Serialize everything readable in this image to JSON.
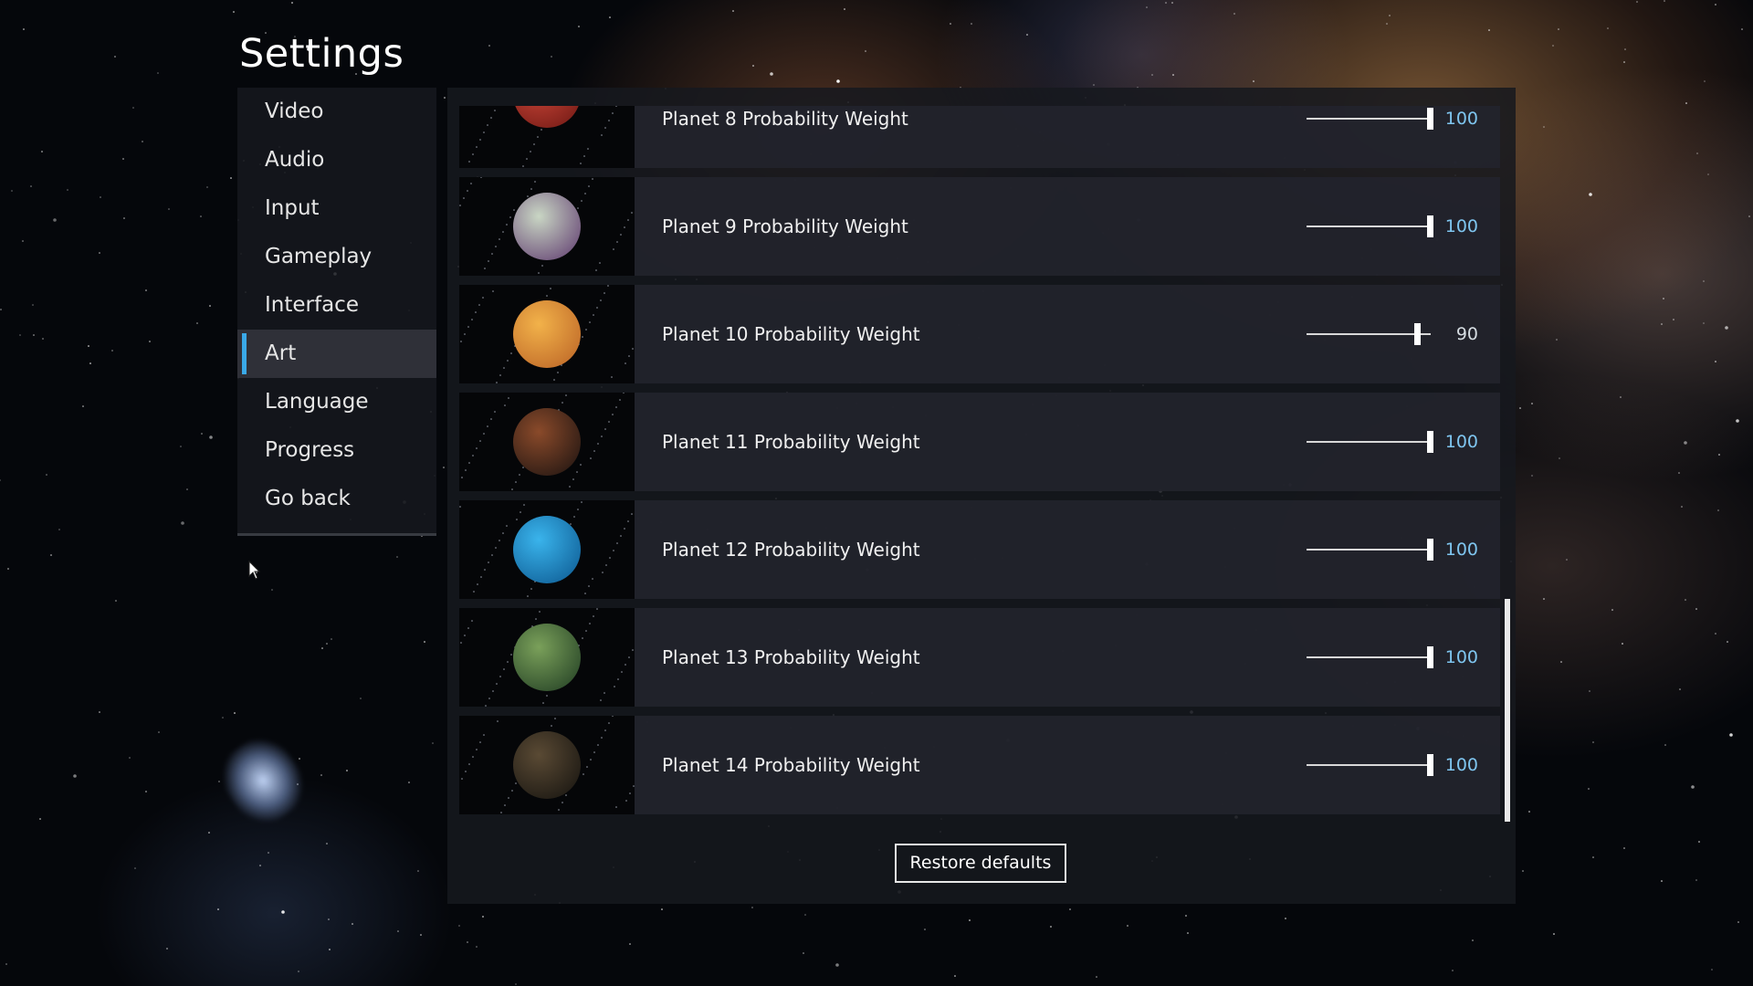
{
  "page_title": "Settings",
  "sidebar": {
    "items": [
      {
        "label": "Video",
        "active": false
      },
      {
        "label": "Audio",
        "active": false
      },
      {
        "label": "Input",
        "active": false
      },
      {
        "label": "Gameplay",
        "active": false
      },
      {
        "label": "Interface",
        "active": false
      },
      {
        "label": "Art",
        "active": true
      },
      {
        "label": "Language",
        "active": false
      },
      {
        "label": "Progress",
        "active": false
      },
      {
        "label": "Go back",
        "active": false
      }
    ]
  },
  "settings_rows": [
    {
      "label": "Planet 8 Probability Weight",
      "value": "100",
      "slider_fraction": 1.0,
      "planet_icon": "red-planet-icon",
      "planet_colors": [
        "#d0483a",
        "#7a1e18"
      ]
    },
    {
      "label": "Planet 9 Probability Weight",
      "value": "100",
      "slider_fraction": 1.0,
      "planet_icon": "crystal-planet-icon",
      "planet_colors": [
        "#c9d6c4",
        "#6d4f7a"
      ]
    },
    {
      "label": "Planet 10 Probability Weight",
      "value": "90",
      "slider_fraction": 0.9,
      "planet_icon": "golden-planet-icon",
      "planet_colors": [
        "#f2b24a",
        "#c26d2a"
      ]
    },
    {
      "label": "Planet 11 Probability Weight",
      "value": "100",
      "slider_fraction": 1.0,
      "planet_icon": "lava-planet-icon",
      "planet_colors": [
        "#8a4a2a",
        "#2a1a14"
      ]
    },
    {
      "label": "Planet 12 Probability Weight",
      "value": "100",
      "slider_fraction": 1.0,
      "planet_icon": "ocean-planet-icon",
      "planet_colors": [
        "#3ab4ec",
        "#12649c"
      ]
    },
    {
      "label": "Planet 13 Probability Weight",
      "value": "100",
      "slider_fraction": 1.0,
      "planet_icon": "forest-planet-icon",
      "planet_colors": [
        "#7aa05a",
        "#2c4a2a"
      ]
    },
    {
      "label": "Planet 14 Probability Weight",
      "value": "100",
      "slider_fraction": 1.0,
      "planet_icon": "dark-planet-icon",
      "planet_colors": [
        "#5a4a34",
        "#1e1a14"
      ]
    }
  ],
  "restore_button": "Restore defaults",
  "colors": {
    "accent": "#3aa9e8",
    "value_text": "#7fc6f0"
  }
}
